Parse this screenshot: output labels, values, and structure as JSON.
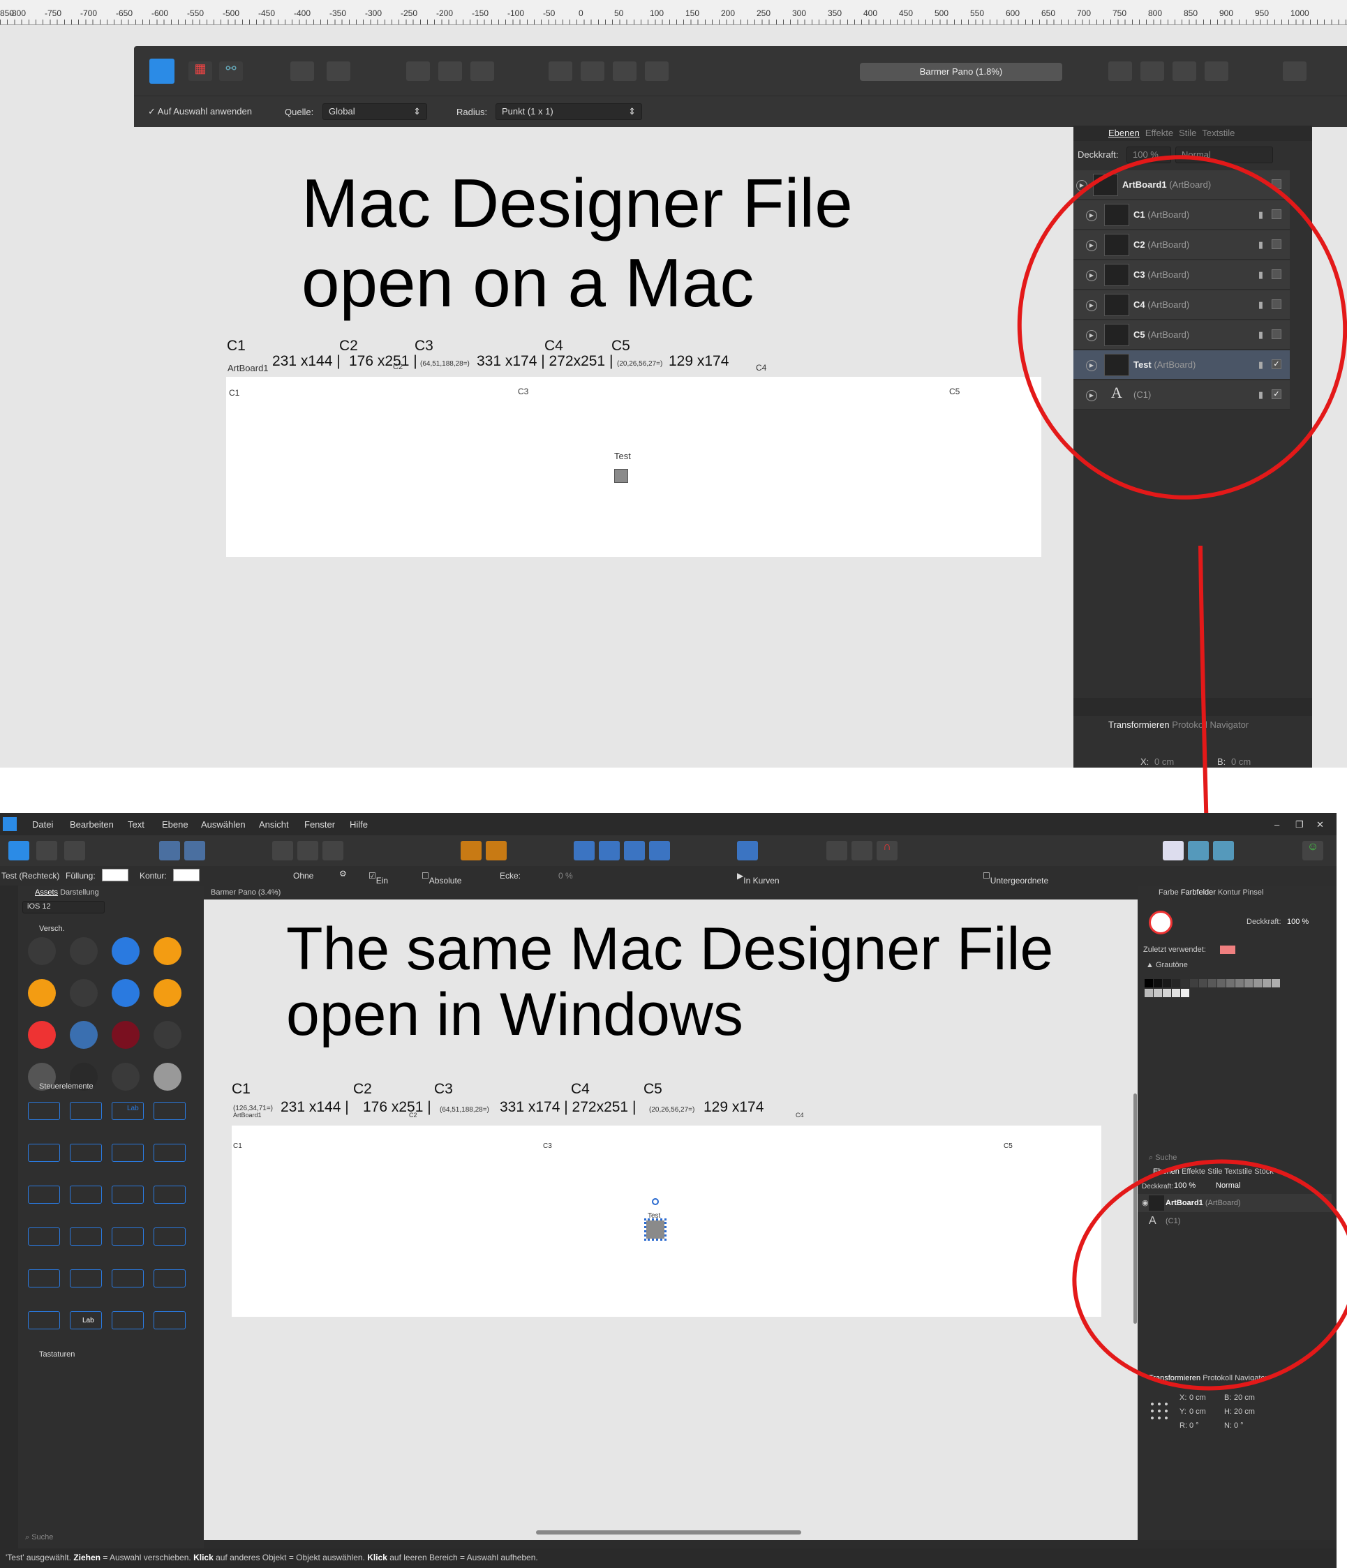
{
  "ruler": {
    "labels": [
      "850",
      "-800",
      "-750",
      "-700",
      "-650",
      "-600",
      "-550",
      "-500",
      "-450",
      "-400",
      "-350",
      "-300",
      "-250",
      "-200",
      "-150",
      "-100",
      "-50",
      "0",
      "50",
      "100",
      "150",
      "200",
      "250",
      "300",
      "350",
      "400",
      "450",
      "500",
      "550",
      "600",
      "650",
      "700",
      "750",
      "800",
      "850",
      "900",
      "950",
      "1000"
    ]
  },
  "mac": {
    "toolbar": {
      "doc_title": "Barmer Pano (1.8%)"
    },
    "context": {
      "apply_label": "Auf Auswahl anwenden",
      "source_label": "Quelle:",
      "source_value": "Global",
      "radius_label": "Radius:",
      "radius_value": "Punkt (1 x 1)"
    },
    "heading_line1": "Mac Designer File",
    "heading_line2": "open on a Mac",
    "clabels": {
      "c1": "C1",
      "c2": "C2",
      "c3": "C3",
      "c4": "C4",
      "c5": "C5",
      "artboard1": "ArtBoard1",
      "dims1": "231 x144 |",
      "dims2": "176 x251 |",
      "dims3": "331 x174 | 272x251 |",
      "dims4": "129 x174",
      "coord1": "(64,51,188,28=)",
      "coord2": "(20,26,56,27=)",
      "c2small": "C2",
      "c4small": "C4"
    },
    "board_labels": {
      "c1": "C1",
      "c3": "C3",
      "c5": "C5",
      "test": "Test"
    },
    "panel": {
      "tabs": [
        "Ebenen",
        "Effekte",
        "Stile",
        "Textstile"
      ],
      "opacity_label": "Deckkraft:",
      "opacity_value": "100 %",
      "blend": "Normal",
      "layers": [
        {
          "name": "ArtBoard1",
          "type": "(ArtBoard)"
        },
        {
          "name": "C1",
          "type": "(ArtBoard)"
        },
        {
          "name": "C2",
          "type": "(ArtBoard)"
        },
        {
          "name": "C3",
          "type": "(ArtBoard)"
        },
        {
          "name": "C4",
          "type": "(ArtBoard)"
        },
        {
          "name": "C5",
          "type": "(ArtBoard)"
        },
        {
          "name": "Test",
          "type": "(ArtBoard)"
        },
        {
          "name": "",
          "type": "(C1)"
        }
      ],
      "bottom_tabs": [
        "Transformieren",
        "Protokoll",
        "Navigator"
      ],
      "x_label": "X:",
      "x_value": "0 cm",
      "b_label": "B:",
      "b_value": "0 cm"
    }
  },
  "win": {
    "menu": [
      "Datei",
      "Bearbeiten",
      "Text",
      "Ebene",
      "Auswählen",
      "Ansicht",
      "Fenster",
      "Hilfe"
    ],
    "context": {
      "selection": "Test (Rechteck)",
      "fill": "Füllung:",
      "stroke": "Kontur:",
      "none": "Ohne",
      "one_radius": "Ein Radius",
      "absolute": "Absolute Größen",
      "corner": "Ecke:",
      "percent": "0 %",
      "curves": "In Kurven umwandeln",
      "protect": "Untergeordnete Elemente schützen"
    },
    "assets": {
      "tabs": [
        "Assets",
        "Darstellung"
      ],
      "set": "iOS 12",
      "sec1": "Versch.",
      "sec2": "Steuerelemente",
      "sec3": "Tastaturen",
      "search": "Suche",
      "lab1": "Lab",
      "lab2": "Lab"
    },
    "doc_tab": "Barmer Pano (3.4%)",
    "heading_line1": "The same Mac Designer File",
    "heading_line2": "open in Windows",
    "clabels": {
      "c1": "C1",
      "c2": "C2",
      "c3": "C3",
      "c4": "C4",
      "c5": "C5",
      "coord0": "(126,34,71=)",
      "artboard1": "ArtBoard1",
      "dims1": "231 x144 |",
      "dims2": "176 x251 |",
      "coord1": "(64,51,188,28=)",
      "dims3": "331 x174 | 272x251 |",
      "coord2": "(20,26,56,27=)",
      "dims4": "129 x174",
      "c2small": "C2",
      "c4small": "C4"
    },
    "board_labels": {
      "c1": "C1",
      "c3": "C3",
      "c5": "C5",
      "test": "Test"
    },
    "rpanel": {
      "tabs": [
        "Farbe",
        "Farbfelder",
        "Kontur",
        "Pinsel"
      ],
      "opacity_label": "Deckkraft:",
      "opacity_value": "100 %",
      "recent": "Zuletzt verwendet:",
      "greys": "Grautöne",
      "search": "Suche",
      "layer_tabs": [
        "Ebenen",
        "Effekte",
        "Stile",
        "Textstile",
        "Stock"
      ],
      "lopacity_label": "Deckkraft:",
      "lopacity_value": "100 %",
      "blend": "Normal",
      "layers": [
        {
          "name": "ArtBoard1",
          "type": "(ArtBoard)"
        },
        {
          "name": "",
          "type": "(C1)"
        }
      ],
      "bottom_tabs": [
        "Transformieren",
        "Protokoll",
        "Navigator"
      ],
      "tx": {
        "x_label": "X:",
        "x": "0 cm",
        "y_label": "Y:",
        "y": "0 cm",
        "b_label": "B:",
        "b": "20 cm",
        "h_label": "H:",
        "h": "20 cm",
        "r_label": "R:",
        "r": "0 °",
        "n_label": "N:",
        "n": "0 °"
      }
    },
    "status": {
      "p1": "'Test' ausgewählt. ",
      "b1": "Ziehen",
      "p2": " = Auswahl verschieben. ",
      "b2": "Klick",
      "p3": " auf anderes Objekt = Objekt auswählen. ",
      "b3": "Klick",
      "p4": " auf leeren Bereich = Auswahl aufheben."
    }
  }
}
